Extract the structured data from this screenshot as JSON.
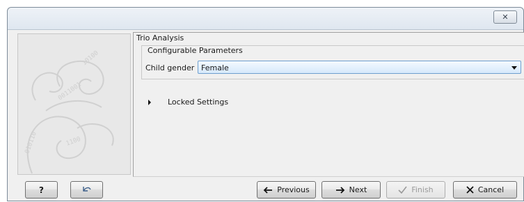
{
  "window": {
    "close_glyph": "✕"
  },
  "content": {
    "wizard_title": "Trio Analysis",
    "group_title": "Configurable Parameters",
    "field_label": "Child gender",
    "field_value": "Female",
    "locked_label": "Locked Settings"
  },
  "footer": {
    "help_label": "?",
    "previous_label": "Previous",
    "next_label": "Next",
    "finish_label": "Finish",
    "cancel_label": "Cancel"
  }
}
